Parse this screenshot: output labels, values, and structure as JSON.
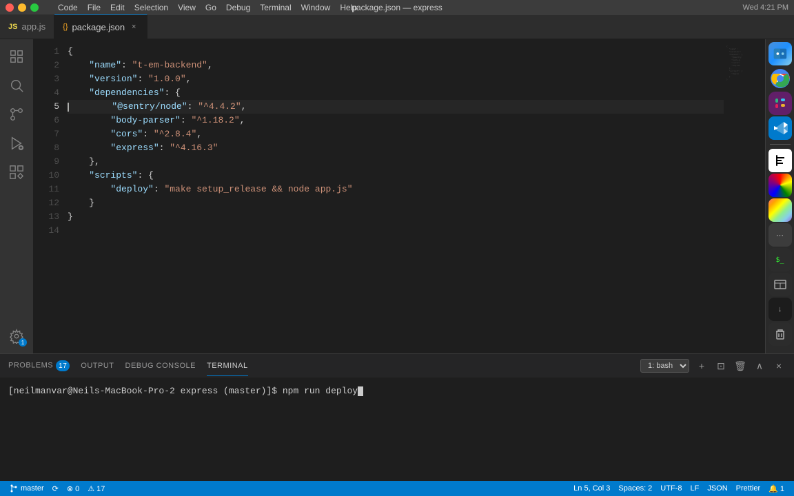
{
  "titleBar": {
    "title": "package.json — express",
    "menu": [
      "Code",
      "File",
      "Edit",
      "Selection",
      "View",
      "Go",
      "Debug",
      "Terminal",
      "Window",
      "Help"
    ]
  },
  "tabs": [
    {
      "id": "app-js",
      "label": "app.js",
      "icon": "JS",
      "active": false,
      "modified": false
    },
    {
      "id": "package-json",
      "label": "package.json",
      "icon": "{}",
      "active": true,
      "modified": false
    }
  ],
  "code": {
    "language": "JSON",
    "lines": [
      {
        "num": 1,
        "content": "{",
        "tokens": [
          {
            "text": "{",
            "class": "j-brace"
          }
        ]
      },
      {
        "num": 2,
        "content": "    \"name\": \"t-em-backend\",",
        "tokens": [
          {
            "text": "    ",
            "class": ""
          },
          {
            "text": "\"name\"",
            "class": "j-key"
          },
          {
            "text": ": ",
            "class": "j-colon"
          },
          {
            "text": "\"t-em-backend\"",
            "class": "j-string"
          },
          {
            "text": ",",
            "class": "j-comma"
          }
        ]
      },
      {
        "num": 3,
        "content": "    \"version\": \"1.0.0\",",
        "tokens": [
          {
            "text": "    ",
            "class": ""
          },
          {
            "text": "\"version\"",
            "class": "j-key"
          },
          {
            "text": ": ",
            "class": "j-colon"
          },
          {
            "text": "\"1.0.0\"",
            "class": "j-string"
          },
          {
            "text": ",",
            "class": "j-comma"
          }
        ]
      },
      {
        "num": 4,
        "content": "    \"dependencies\": {",
        "tokens": [
          {
            "text": "    ",
            "class": ""
          },
          {
            "text": "\"dependencies\"",
            "class": "j-key"
          },
          {
            "text": ": ",
            "class": "j-colon"
          },
          {
            "text": "{",
            "class": "j-brace"
          }
        ]
      },
      {
        "num": 5,
        "content": "        \"@sentry/node\": \"^4.4.2\",",
        "active": true,
        "tokens": [
          {
            "text": "        ",
            "class": ""
          },
          {
            "text": "\"@sentry/node\"",
            "class": "j-key"
          },
          {
            "text": ": ",
            "class": "j-colon"
          },
          {
            "text": "\"^4.4.2\"",
            "class": "j-string"
          },
          {
            "text": ",",
            "class": "j-comma"
          }
        ]
      },
      {
        "num": 6,
        "content": "        \"body-parser\": \"^1.18.2\",",
        "tokens": [
          {
            "text": "        ",
            "class": ""
          },
          {
            "text": "\"body-parser\"",
            "class": "j-key"
          },
          {
            "text": ": ",
            "class": "j-colon"
          },
          {
            "text": "\"^1.18.2\"",
            "class": "j-string"
          },
          {
            "text": ",",
            "class": "j-comma"
          }
        ]
      },
      {
        "num": 7,
        "content": "        \"cors\": \"^2.8.4\",",
        "tokens": [
          {
            "text": "        ",
            "class": ""
          },
          {
            "text": "\"cors\"",
            "class": "j-key"
          },
          {
            "text": ": ",
            "class": "j-colon"
          },
          {
            "text": "\"^2.8.4\"",
            "class": "j-string"
          },
          {
            "text": ",",
            "class": "j-comma"
          }
        ]
      },
      {
        "num": 8,
        "content": "        \"express\": \"^4.16.3\"",
        "tokens": [
          {
            "text": "        ",
            "class": ""
          },
          {
            "text": "\"express\"",
            "class": "j-key"
          },
          {
            "text": ": ",
            "class": "j-colon"
          },
          {
            "text": "\"^4.16.3\"",
            "class": "j-string"
          }
        ]
      },
      {
        "num": 9,
        "content": "    },",
        "tokens": [
          {
            "text": "    ",
            "class": ""
          },
          {
            "text": "}",
            "class": "j-brace"
          },
          {
            "text": ",",
            "class": "j-comma"
          }
        ]
      },
      {
        "num": 10,
        "content": "    \"scripts\": {",
        "tokens": [
          {
            "text": "    ",
            "class": ""
          },
          {
            "text": "\"scripts\"",
            "class": "j-key"
          },
          {
            "text": ": ",
            "class": "j-colon"
          },
          {
            "text": "{",
            "class": "j-brace"
          }
        ]
      },
      {
        "num": 11,
        "content": "        \"deploy\": \"make setup_release && node app.js\"",
        "tokens": [
          {
            "text": "        ",
            "class": ""
          },
          {
            "text": "\"deploy\"",
            "class": "j-key"
          },
          {
            "text": ": ",
            "class": "j-colon"
          },
          {
            "text": "\"make setup_release && node app.js\"",
            "class": "j-string"
          }
        ]
      },
      {
        "num": 12,
        "content": "    }",
        "tokens": [
          {
            "text": "    ",
            "class": ""
          },
          {
            "text": "}",
            "class": "j-brace"
          }
        ]
      },
      {
        "num": 13,
        "content": "}",
        "tokens": [
          {
            "text": "}",
            "class": "j-brace"
          }
        ]
      },
      {
        "num": 14,
        "content": "",
        "tokens": []
      }
    ]
  },
  "panel": {
    "tabs": [
      {
        "label": "PROBLEMS",
        "badge": "17",
        "active": false
      },
      {
        "label": "OUTPUT",
        "badge": null,
        "active": false
      },
      {
        "label": "DEBUG CONSOLE",
        "badge": null,
        "active": false
      },
      {
        "label": "TERMINAL",
        "badge": null,
        "active": true
      }
    ],
    "terminalSelect": "1: bash",
    "terminalContent": "[neilmanvar@Neils-MacBook-Pro-2 express (master)]$ npm run deploy"
  },
  "statusBar": {
    "branch": "master",
    "sync": "⟳",
    "errors": "⊗ 0",
    "warnings": "⚠ 17",
    "position": "Ln 5, Col 3",
    "spaces": "Spaces: 2",
    "encoding": "UTF-8",
    "lineEnding": "LF",
    "language": "JSON",
    "prettier": "Prettier",
    "notifications": "🔔 1"
  },
  "activityBar": {
    "icons": [
      {
        "name": "explorer",
        "symbol": "⎘",
        "active": false
      },
      {
        "name": "search",
        "symbol": "🔍",
        "active": false
      },
      {
        "name": "source-control",
        "symbol": "⑂",
        "active": false
      },
      {
        "name": "debug",
        "symbol": "⑇",
        "active": false
      },
      {
        "name": "extensions",
        "symbol": "⊞",
        "active": false
      }
    ],
    "bottomIcons": [
      {
        "name": "settings",
        "symbol": "⚙",
        "active": false
      }
    ]
  }
}
